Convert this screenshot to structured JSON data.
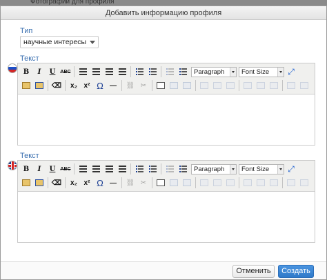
{
  "backdrop": {
    "text": "Фотографии для профиля"
  },
  "dialog": {
    "title": "Добавить информацию профиля"
  },
  "type_field": {
    "label": "Тип",
    "value": "научные интересы"
  },
  "editors": [
    {
      "label": "Текст",
      "language": "ru",
      "flag_icon": "russia-flag-icon",
      "format": "Paragraph",
      "font_size": "Font Size",
      "content": ""
    },
    {
      "label": "Текст",
      "language": "en",
      "flag_icon": "uk-flag-icon",
      "format": "Paragraph",
      "font_size": "Font Size",
      "content": ""
    }
  ],
  "toolbar": {
    "bold": "B",
    "italic": "I",
    "underline": "U",
    "strikethrough": "ABC",
    "subscript": "x₂",
    "superscript": "x²",
    "omega": "Ω",
    "hr": "—"
  },
  "buttons": {
    "cancel": "Отменить",
    "create": "Создать"
  },
  "colors": {
    "accent": "#2f79c9",
    "label": "#3a6fb0"
  }
}
